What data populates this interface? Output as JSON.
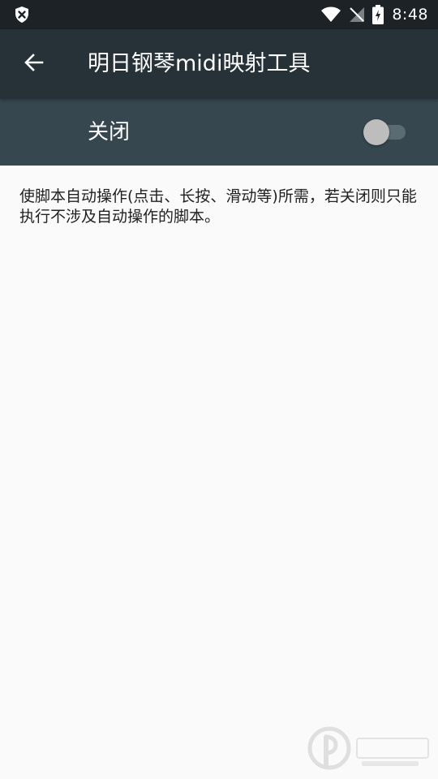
{
  "status_bar": {
    "time": "8:48",
    "icons": [
      "shield-x-icon",
      "wifi-icon",
      "no-signal-icon",
      "battery-charging-icon"
    ]
  },
  "toolbar": {
    "title": "明日钢琴midi映射工具",
    "back_icon": "arrow-left-icon"
  },
  "switch_bar": {
    "label": "关闭",
    "toggle_on": false
  },
  "description": "使脚本自动操作(点击、长按、滑动等)所需，若关闭则只能执行不涉及自动操作的脚本。",
  "colors": {
    "status_bar": "#1c2226",
    "toolbar": "#263238",
    "switch_bar": "#37474f",
    "background": "#fafafa",
    "text": "#212121"
  }
}
